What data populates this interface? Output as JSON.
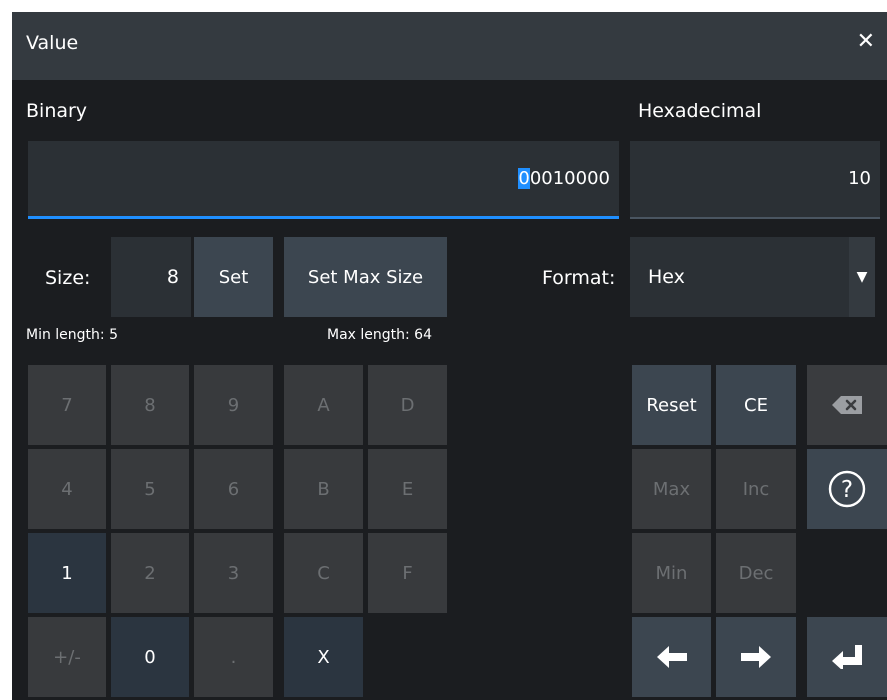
{
  "dialog": {
    "title": "Value",
    "close_icon": "close-icon"
  },
  "binary": {
    "label": "Binary",
    "cursor_digit": "0",
    "rest": "0010000"
  },
  "hexadecimal": {
    "label": "Hexadecimal",
    "value": "10"
  },
  "size": {
    "label": "Size:",
    "value": "8",
    "set_label": "Set",
    "set_max_label": "Set Max Size",
    "min_length": "Min length: 5",
    "max_length": "Max length: 64"
  },
  "format": {
    "label": "Format:",
    "value": "Hex",
    "dropdown_icon": "triangle-down-icon"
  },
  "keypad": {
    "k7": "7",
    "k8": "8",
    "k9": "9",
    "kA": "A",
    "kD": "D",
    "k4": "4",
    "k5": "5",
    "k6": "6",
    "kB": "B",
    "kE": "E",
    "k1": "1",
    "k2": "2",
    "k3": "3",
    "kC": "C",
    "kF": "F",
    "kpm": "+/-",
    "k0": "0",
    "kdot": ".",
    "kX": "X"
  },
  "actions": {
    "reset": "Reset",
    "ce": "CE",
    "max": "Max",
    "inc": "Inc",
    "min": "Min",
    "dec": "Dec",
    "backspace_icon": "backspace-icon",
    "help_icon": "help-icon",
    "left_icon": "arrow-left-icon",
    "right_icon": "arrow-right-icon",
    "enter_icon": "enter-icon"
  },
  "colors": {
    "accent": "#1f8fff",
    "background": "#1b1d20",
    "titlebar": "#343a40"
  }
}
